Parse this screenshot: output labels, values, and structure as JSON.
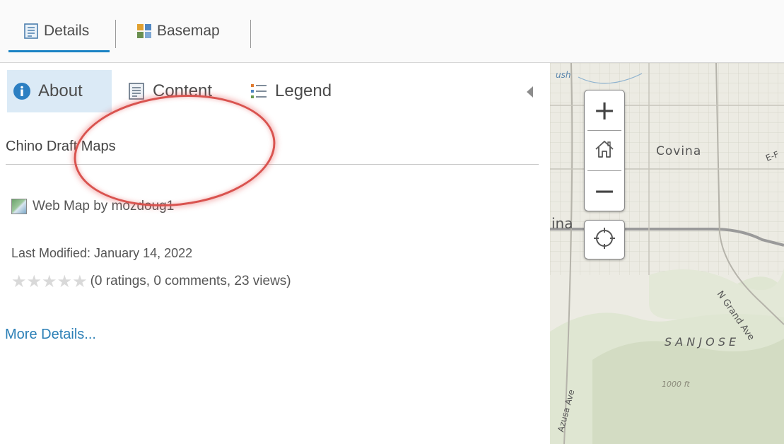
{
  "top_tabs": [
    {
      "label": "Details",
      "icon": "details-icon",
      "active": true
    },
    {
      "label": "Basemap",
      "icon": "basemap-grid-icon",
      "active": false
    }
  ],
  "sub_tabs": [
    {
      "label": "About",
      "icon": "info-icon",
      "active": true
    },
    {
      "label": "Content",
      "icon": "content-list-icon",
      "active": false
    },
    {
      "label": "Legend",
      "icon": "legend-list-icon",
      "active": false
    }
  ],
  "about": {
    "title": "Chino Draft Maps",
    "byline": "Web Map by mozdoug1",
    "modified": "Last Modified: January 14, 2022",
    "rating_stars": 0,
    "stats": "(0 ratings, 0 comments, 23 views)",
    "more_details": "More Details..."
  },
  "map": {
    "labels": [
      "Covina",
      "ina",
      "N Grand Ave",
      "S A N   J O S E",
      "1000 ft",
      "Azusa Ave",
      "ush",
      "E-F"
    ],
    "controls": {
      "zoom_in": "+",
      "zoom_out": "−"
    }
  },
  "colors": {
    "accent": "#1b83c4",
    "active_tab_bg": "#dbeaf6",
    "link": "#2b7fb6",
    "annotation": "#d9534f"
  }
}
